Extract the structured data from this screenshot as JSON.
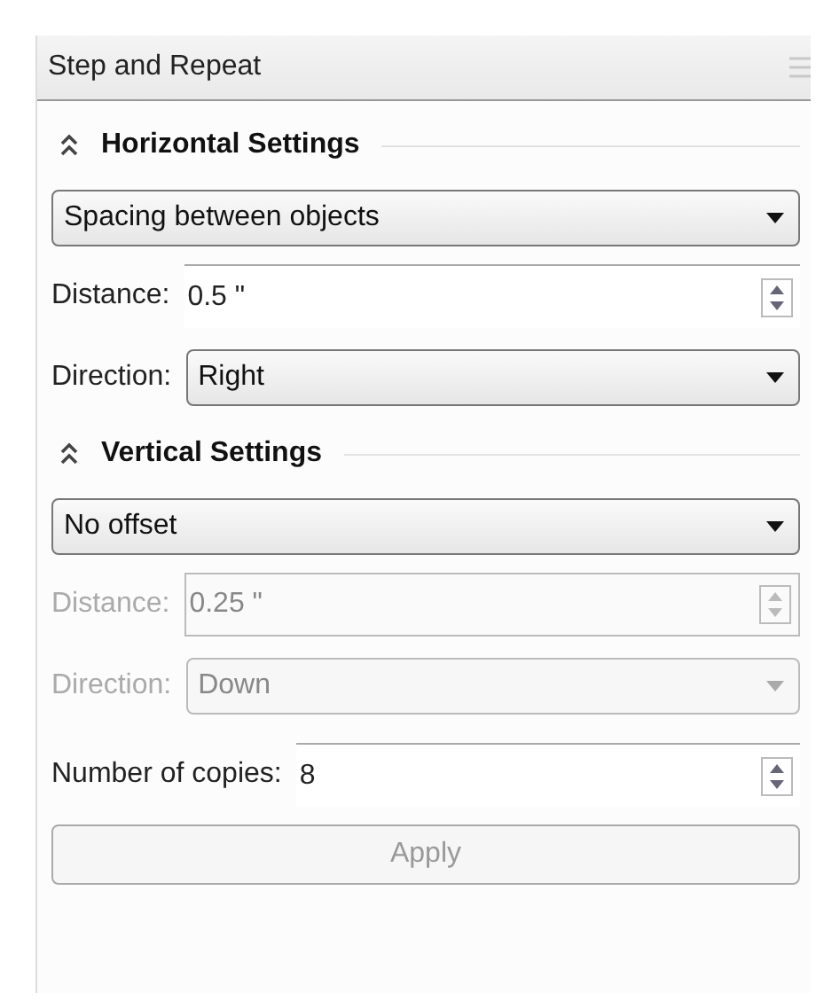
{
  "panel": {
    "title": "Step and Repeat"
  },
  "sections": [
    {
      "title": "Horizontal Settings",
      "expanded": true,
      "mode": "Spacing between objects",
      "distance": {
        "label": "Distance:",
        "value": "0.5 \"",
        "disabled": false
      },
      "direction": {
        "label": "Direction:",
        "value": "Right",
        "disabled": false
      }
    },
    {
      "title": "Vertical Settings",
      "expanded": true,
      "mode": "No offset",
      "distance": {
        "label": "Distance:",
        "value": "0.25 \"",
        "disabled": true
      },
      "direction": {
        "label": "Direction:",
        "value": "Down",
        "disabled": true
      }
    }
  ],
  "copies": {
    "label": "Number of copies:",
    "value": "8"
  },
  "apply": {
    "label": "Apply",
    "disabled": true
  }
}
